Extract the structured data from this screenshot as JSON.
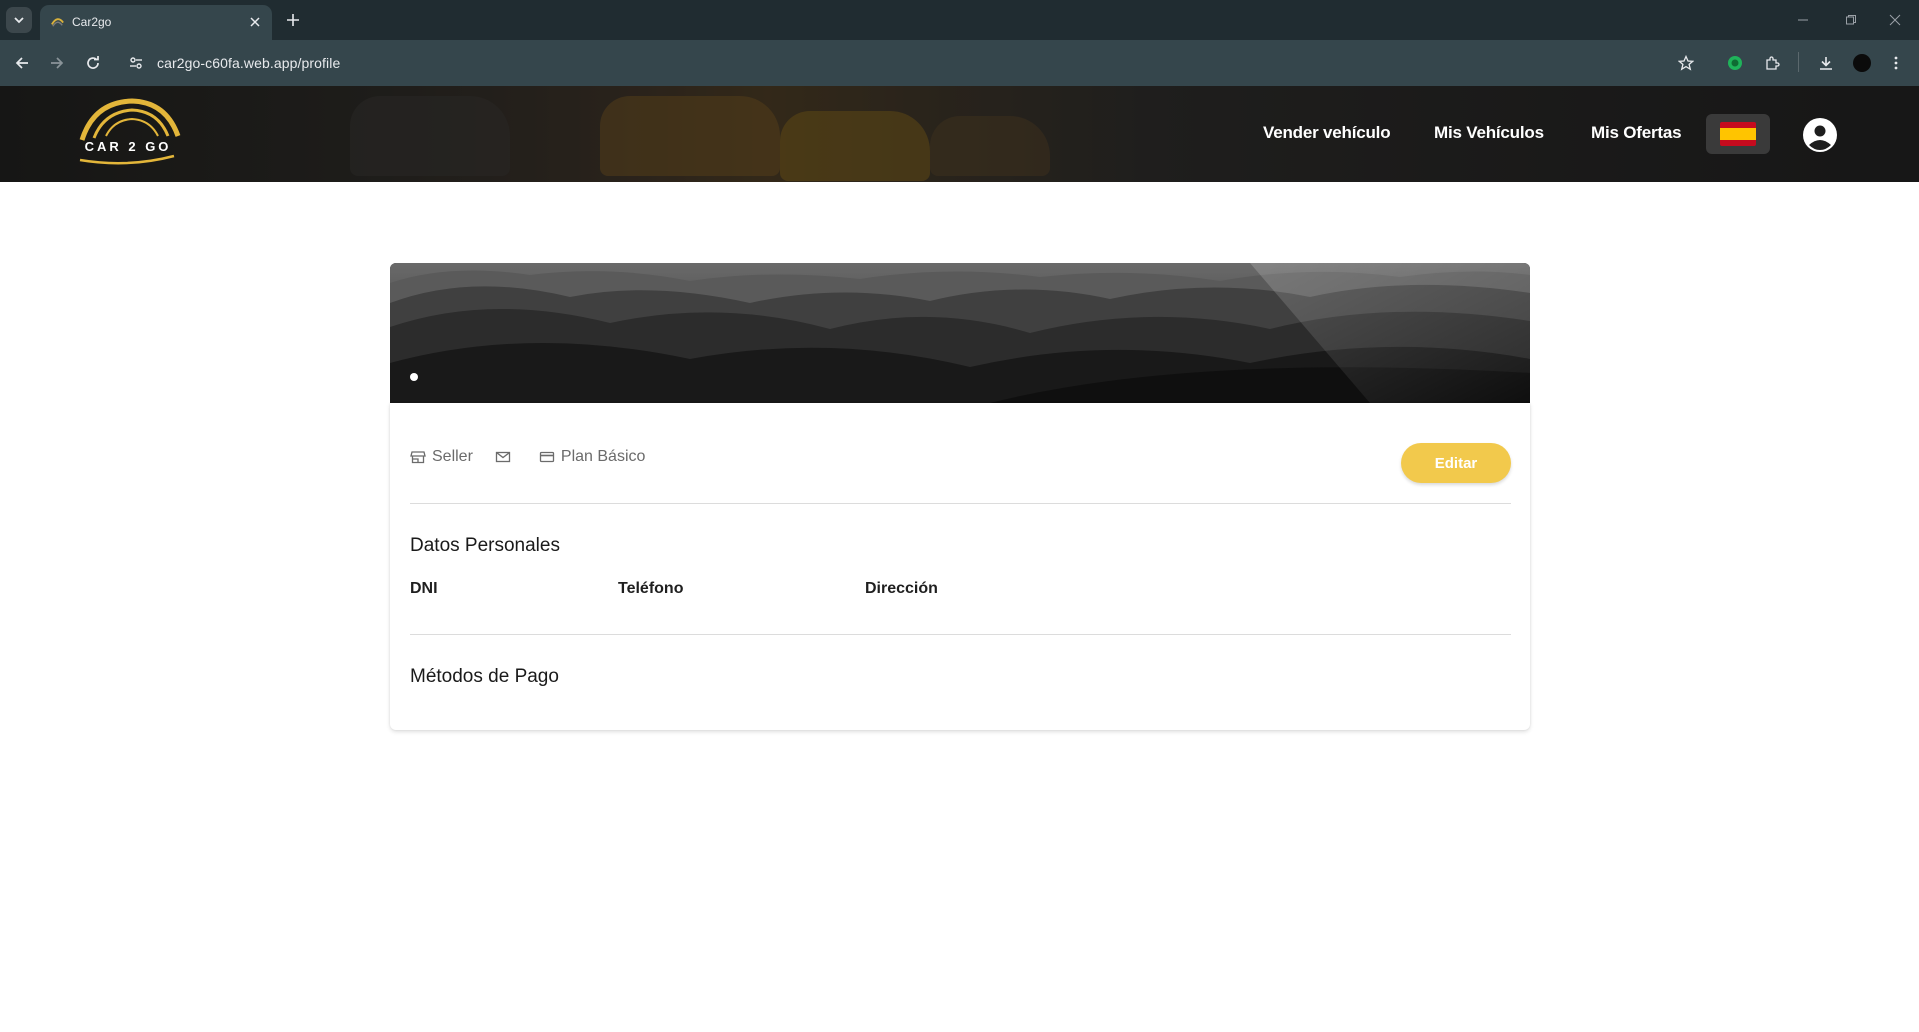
{
  "browser": {
    "tab_title": "Car2go",
    "url": "car2go-c60fa.web.app/profile"
  },
  "header": {
    "logo_text": "CAR 2 GO",
    "nav": {
      "sell_vehicle": "Vender vehículo",
      "my_vehicles": "Mis Vehículos",
      "my_offers": "Mis Ofertas"
    },
    "language_flag": "spain-flag-icon",
    "colors": {
      "flag_red": "#c60b1e",
      "flag_yellow": "#ffc400"
    }
  },
  "profile": {
    "role": "Seller",
    "email": "",
    "plan": "Plan Básico",
    "edit_label": "Editar",
    "accent_color": "#f2c94c",
    "personal_section": {
      "title": "Datos Personales",
      "fields": {
        "dni": "DNI",
        "phone": "Teléfono",
        "address": "Dirección"
      }
    },
    "payment_section": {
      "title": "Métodos de Pago"
    }
  }
}
